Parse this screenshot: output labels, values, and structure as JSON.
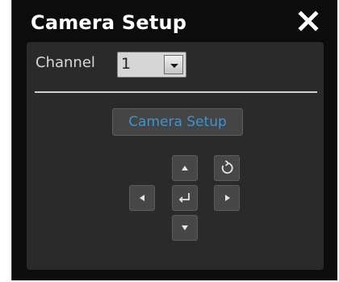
{
  "dialog": {
    "title": "Camera Setup",
    "close_icon": "close-icon"
  },
  "channel": {
    "label": "Channel",
    "selected_value": "1",
    "dropdown_icon": "chevron-down-icon"
  },
  "actions": {
    "camera_setup_label": "Camera Setup"
  },
  "ptz": {
    "up_icon": "arrow-up-icon",
    "down_icon": "arrow-down-icon",
    "left_icon": "arrow-left-icon",
    "right_icon": "arrow-right-icon",
    "enter_icon": "enter-icon",
    "rotate_icon": "rotate-icon"
  },
  "colors": {
    "dialog_background": "#0c0c0c",
    "panel_background": "#2a2a2a",
    "accent_text": "#3a95d4"
  }
}
